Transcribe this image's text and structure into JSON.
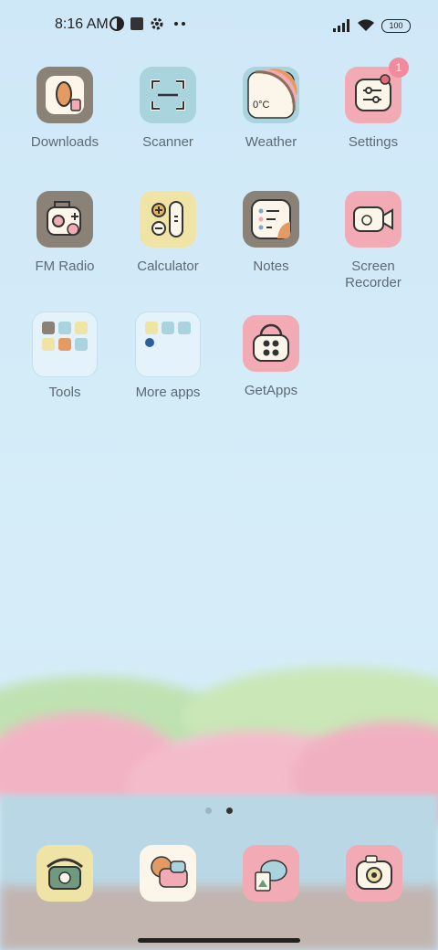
{
  "status_bar": {
    "time": "8:16 AM",
    "battery": "100"
  },
  "apps": [
    {
      "label": "Downloads"
    },
    {
      "label": "Scanner"
    },
    {
      "label": "Weather",
      "tile_text": "0°C"
    },
    {
      "label": "Settings",
      "badge": "1"
    },
    {
      "label": "FM Radio"
    },
    {
      "label": "Calculator"
    },
    {
      "label": "Notes"
    },
    {
      "label": "Screen Recorder"
    },
    {
      "label": "Tools"
    },
    {
      "label": "More apps"
    },
    {
      "label": "GetApps"
    }
  ],
  "colors": {
    "accent_pink": "#f2aab4",
    "tile_gray": "#8a8276",
    "tile_blue": "#a9d3dd",
    "tile_yellow": "#efe3a6",
    "badge": "#f28a9d"
  },
  "page_indicator": {
    "current_page": 2,
    "total_pages": 2
  }
}
